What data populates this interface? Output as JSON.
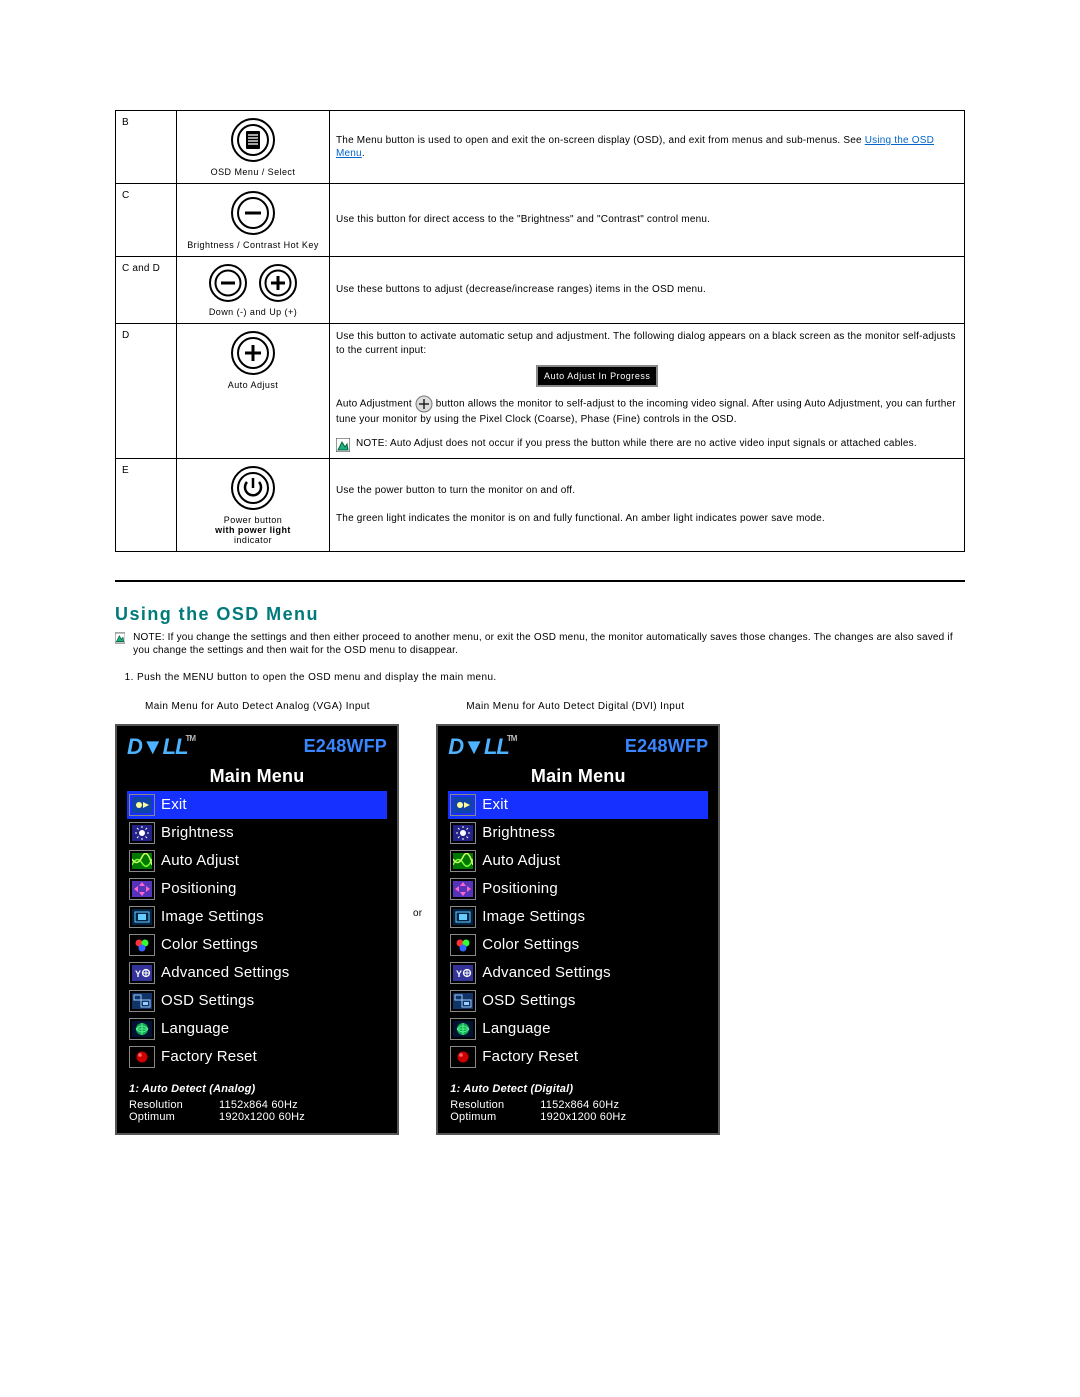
{
  "buttons": [
    {
      "key": "B",
      "caption": "OSD Menu /  Select",
      "desc_pre": "The Menu button is used to open and exit the on-screen display (OSD), and exit from menus and sub-menus. See ",
      "link": "Using the OSD Menu",
      "desc_post": "."
    },
    {
      "key": "C",
      "caption": "Brightness / Contrast Hot Key",
      "desc": "Use this button for direct access to the \"Brightness\" and \"Contrast\" control menu."
    },
    {
      "key": "C and D",
      "caption": "Down (-) and Up (+)",
      "desc": "Use these buttons to adjust (decrease/increase ranges) items in the OSD menu."
    },
    {
      "key": "D",
      "caption": "Auto Adjust",
      "desc1": "Use this button to activate automatic setup and adjustment. The following dialog appears on a black screen as the monitor self-adjusts to the current input:",
      "badge": "Auto Adjust In Progress",
      "desc2a": "Auto Adjustment ",
      "desc2b": " button allows the monitor to self-adjust to the incoming video signal. After using Auto Adjustment, you can further tune your monitor by using the Pixel Clock (Coarse), Phase (Fine) controls in the OSD.",
      "note": "NOTE: Auto Adjust does not occur if you press the button while there are no active video input signals or attached cables."
    },
    {
      "key": "E",
      "caption_line1": "Power button",
      "caption_line2": "with power light",
      "caption_line3": "indicator",
      "desc1": "Use the power button to turn the monitor on and off.",
      "desc2": "The green light indicates the monitor is on and fully functional. An amber light indicates power save mode."
    }
  ],
  "section": {
    "heading": "Using the OSD Menu",
    "note": "NOTE: If you change the settings and then either proceed to another menu, or exit the OSD menu, the monitor automatically saves those changes. The changes are also saved if you change the settings and then wait for the OSD menu to disappear.",
    "step1": "Push the MENU button to open the OSD menu and display the main menu."
  },
  "menus": {
    "left_title": "Main Menu for Auto Detect Analog (VGA) Input",
    "right_title": "Main Menu for Auto Detect Digital (DVI) Input",
    "or": "or",
    "osd": {
      "brand": "DELL",
      "tm": "TM",
      "model": "E248WFP",
      "main": "Main Menu",
      "items": [
        "Exit",
        "Brightness",
        "Auto Adjust",
        "Positioning",
        "Image Settings",
        "Color Settings",
        "Advanced Settings",
        "OSD Settings",
        "Language",
        "Factory Reset"
      ],
      "footer_left": {
        "mode": "1: Auto Detect (Analog)",
        "res_label": "Resolution",
        "res": "1152x864   60Hz",
        "opt_label": "Optimum",
        "opt": "1920x1200  60Hz"
      },
      "footer_right": {
        "mode": "1: Auto Detect (Digital)",
        "res_label": "Resolution",
        "res": "1152x864   60Hz",
        "opt_label": "Optimum",
        "opt": "1920x1200  60Hz"
      }
    }
  }
}
